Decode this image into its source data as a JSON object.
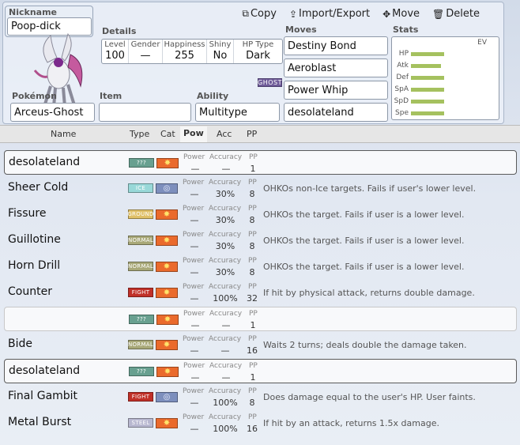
{
  "toolbar": {
    "copy": "Copy",
    "import_export": "Import/Export",
    "move": "Move",
    "delete": "Delete"
  },
  "set": {
    "nickname_label": "Nickname",
    "nickname": "Poop-dick",
    "details_label": "Details",
    "level_label": "Level",
    "level": "100",
    "gender_label": "Gender",
    "gender": "—",
    "happiness_label": "Happiness",
    "happiness": "255",
    "shiny_label": "Shiny",
    "shiny": "No",
    "hptype_label": "HP Type",
    "hptype": "Dark",
    "type_tag": "GHOST",
    "pokemon_label": "Pokémon",
    "pokemon": "Arceus-Ghost",
    "item_label": "Item",
    "item": "",
    "ability_label": "Ability",
    "ability": "Multitype",
    "moves_label": "Moves",
    "moves": [
      "Destiny Bond",
      "Aeroblast",
      "Power Whip",
      "desolateland"
    ],
    "stats_label": "Stats",
    "ev_label": "EV",
    "stats": [
      {
        "name": "HP",
        "fraction": 0.3
      },
      {
        "name": "Atk",
        "fraction": 0.27
      },
      {
        "name": "Def",
        "fraction": 0.3
      },
      {
        "name": "SpA",
        "fraction": 0.3
      },
      {
        "name": "SpD",
        "fraction": 0.3
      },
      {
        "name": "Spe",
        "fraction": 0.3
      }
    ]
  },
  "columns": {
    "name": "Name",
    "type": "Type",
    "cat": "Cat",
    "pow": "Pow",
    "acc": "Acc",
    "pp": "PP"
  },
  "row_labels": {
    "power": "Power",
    "accuracy": "Accuracy",
    "pp": "PP"
  },
  "type_colors": {
    "???": "#68a090",
    "ICE": "#98d8d8",
    "GROUND": "#e0c068",
    "NORMAL": "#a8a878",
    "FIGHT": "#c03028",
    "STEEL": "#b8b8d0"
  },
  "move_rows": [
    {
      "name": "desolateland",
      "type": "???",
      "cat": "phys",
      "power": "—",
      "acc": "—",
      "pp": "1",
      "desc": "",
      "style": "boxed"
    },
    {
      "name": "Sheer Cold",
      "type": "ICE",
      "cat": "spec",
      "power": "—",
      "acc": "30%",
      "pp": "8",
      "desc": "OHKOs non-Ice targets. Fails if user's lower level.",
      "style": ""
    },
    {
      "name": "Fissure",
      "type": "GROUND",
      "cat": "phys",
      "power": "—",
      "acc": "30%",
      "pp": "8",
      "desc": "OHKOs the target. Fails if user is a lower level.",
      "style": ""
    },
    {
      "name": "Guillotine",
      "type": "NORMAL",
      "cat": "phys",
      "power": "—",
      "acc": "30%",
      "pp": "8",
      "desc": "OHKOs the target. Fails if user is a lower level.",
      "style": ""
    },
    {
      "name": "Horn Drill",
      "type": "NORMAL",
      "cat": "phys",
      "power": "—",
      "acc": "30%",
      "pp": "8",
      "desc": "OHKOs the target. Fails if user is a lower level.",
      "style": ""
    },
    {
      "name": "Counter",
      "type": "FIGHT",
      "cat": "phys",
      "power": "—",
      "acc": "100%",
      "pp": "32",
      "desc": "If hit by physical attack, returns double damage.",
      "style": ""
    },
    {
      "name": "",
      "type": "???",
      "cat": "phys",
      "power": "—",
      "acc": "—",
      "pp": "1",
      "desc": "",
      "style": "blank"
    },
    {
      "name": "Bide",
      "type": "NORMAL",
      "cat": "phys",
      "power": "—",
      "acc": "—",
      "pp": "16",
      "desc": "Waits 2 turns; deals double the damage taken.",
      "style": ""
    },
    {
      "name": "desolateland",
      "type": "???",
      "cat": "phys",
      "power": "—",
      "acc": "—",
      "pp": "1",
      "desc": "",
      "style": "boxed"
    },
    {
      "name": "Final Gambit",
      "type": "FIGHT",
      "cat": "spec",
      "power": "—",
      "acc": "100%",
      "pp": "8",
      "desc": "Does damage equal to the user's HP. User faints.",
      "style": ""
    },
    {
      "name": "Metal Burst",
      "type": "STEEL",
      "cat": "phys",
      "power": "—",
      "acc": "100%",
      "pp": "16",
      "desc": "If hit by an attack, returns 1.5x damage.",
      "style": ""
    }
  ]
}
